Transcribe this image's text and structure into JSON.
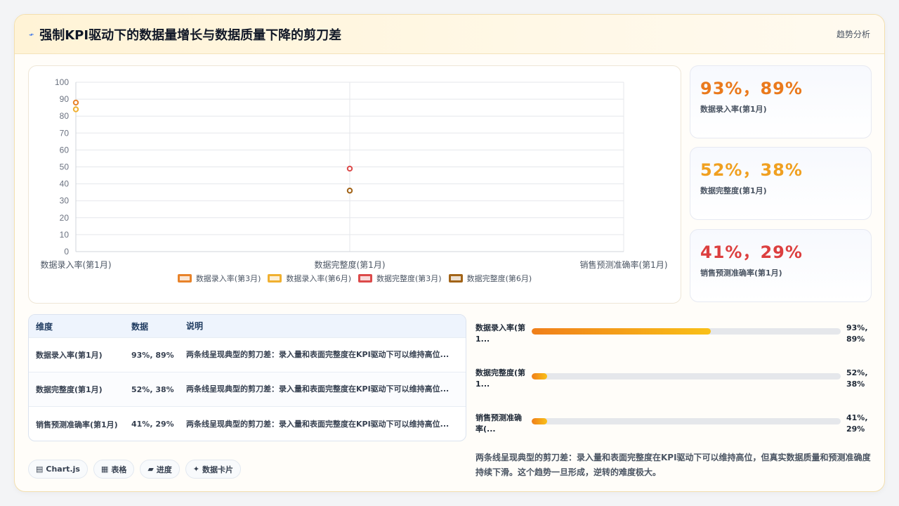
{
  "header": {
    "icon": "trend-icon",
    "title": "强制KPI驱动下的数据量增长与数据质量下降的剪刀差",
    "right_label": "趋势分析"
  },
  "chart_data": {
    "type": "scatter",
    "categories": [
      "数据录入率(第1月)",
      "数据完整度(第1月)",
      "销售预测准确率(第1月)"
    ],
    "ylim": [
      0,
      100
    ],
    "yticks": [
      0,
      10,
      20,
      30,
      40,
      50,
      60,
      70,
      80,
      90,
      100
    ],
    "grid": true,
    "legend_position": "bottom",
    "series": [
      {
        "name": "数据录入率(第3月)",
        "color": "#e8832a",
        "values": [
          88,
          null,
          null
        ]
      },
      {
        "name": "数据录入率(第6月)",
        "color": "#f0b030",
        "values": [
          84,
          null,
          null
        ]
      },
      {
        "name": "数据完整度(第3月)",
        "color": "#dc4a4a",
        "values": [
          null,
          49,
          null
        ]
      },
      {
        "name": "数据完整度(第6月)",
        "color": "#a26418",
        "values": [
          null,
          36,
          null
        ]
      }
    ]
  },
  "stats": [
    {
      "value": "93%，89%",
      "label": "数据录入率(第1月)",
      "color": "#ea7a1c"
    },
    {
      "value": "52%，38%",
      "label": "数据完整度(第1月)",
      "color": "#f0a020"
    },
    {
      "value": "41%，29%",
      "label": "销售预测准确率(第1月)",
      "color": "#dc3f3f"
    }
  ],
  "table": {
    "headers": [
      "维度",
      "数据",
      "说明"
    ],
    "rows": [
      {
        "dim": "数据录入率(第1月)",
        "data": "93%, 89%",
        "desc": "两条线呈现典型的剪刀差：录入量和表面完整度在KPI驱动下可以维持高位..."
      },
      {
        "dim": "数据完整度(第1月)",
        "data": "52%, 38%",
        "desc": "两条线呈现典型的剪刀差：录入量和表面完整度在KPI驱动下可以维持高位..."
      },
      {
        "dim": "销售预测准确率(第1月)",
        "data": "41%, 29%",
        "desc": "两条线呈现典型的剪刀差：录入量和表面完整度在KPI驱动下可以维持高位..."
      }
    ]
  },
  "progress": [
    {
      "label": "数据录入率(第1...",
      "value_text": "93%, 89%",
      "percent": 58
    },
    {
      "label": "数据完整度(第1...",
      "value_text": "52%, 38%",
      "percent": 5
    },
    {
      "label": "销售预测准确率(...",
      "value_text": "41%, 29%",
      "percent": 5
    }
  ],
  "note": "两条线呈现典型的剪刀差：录入量和表面完整度在KPI驱动下可以维持高位，但真实数据质量和预测准确度持续下滑。这个趋势一旦形成，逆转的难度极大。",
  "chips": [
    {
      "icon": "▤",
      "label": "Chart.js"
    },
    {
      "icon": "▦",
      "label": "表格"
    },
    {
      "icon": "▰",
      "label": "进度"
    },
    {
      "icon": "✦",
      "label": "数据卡片"
    }
  ]
}
